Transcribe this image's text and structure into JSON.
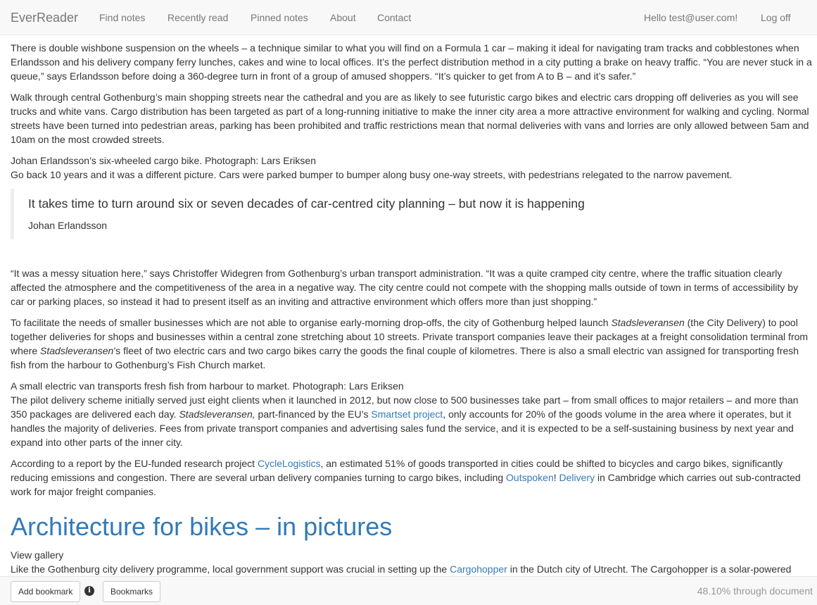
{
  "navbar": {
    "brand": "EverReader",
    "links": [
      "Find notes",
      "Recently read",
      "Pinned notes",
      "About",
      "Contact"
    ],
    "greeting": "Hello test@user.com!",
    "logout": "Log off"
  },
  "article": {
    "p1": "There is double wishbone suspension on the wheels – a technique similar to what you will find on a Formula 1 car – making it ideal for navigating tram tracks and cobblestones when Erlandsson and his delivery company ferry lunches, cakes and wine to local offices. It’s the perfect distribution method in a city putting a brake on heavy traffic. “You are never stuck in a queue,” says Erlandsson before doing a 360-degree turn in front of a group of amused shoppers. “It’s quicker to get from A to B – and it’s safer.”",
    "p2": "Walk through central Gothenburg’s main shopping streets near the cathedral and you are as likely to see futuristic cargo bikes and electric cars dropping off deliveries as you will see trucks and white vans. Cargo distribution has been targeted as part of a long-running initiative to make the inner city area a more attractive environment for walking and cycling. Normal streets have been turned into pedestrian areas, parking has been prohibited and traffic restrictions mean that normal deliveries with vans and lorries are only allowed between 5am and 10am on the most crowded streets.",
    "caption1": "Johan Erlandsson’s six-wheeled cargo bike. Photograph: Lars Eriksen",
    "p3": "Go back 10 years and it was a different picture. Cars were parked bumper to bumper along busy one-way streets, with pedestrians relegated to the narrow pavement.",
    "quote": "It takes time to turn around six or seven decades of car-centred city planning – but now it is happening",
    "quote_author": "Johan Erlandsson",
    "p4": "“It was a messy situation here,” says Christoffer Widegren from Gothenburg’s urban transport administration. “It was a quite cramped city centre, where the traffic situation clearly affected the atmosphere and the competitiveness of the area in a negative way. The city centre could not compete with the shopping malls outside of town in terms of accessibility by car or parking places, so instead it had to present itself as an inviting and attractive environment which offers more than just shopping.”",
    "p5": {
      "a": "To facilitate the needs of smaller businesses which are not able to organise early-morning drop-offs, the city of Gothenburg helped launch ",
      "em1": "Stadsleveransen",
      "b": " (the City Delivery) to pool together deliveries for shops and businesses within a central zone stretching about 10 streets. Private transport companies leave their packages at a freight consolidation terminal from where ",
      "em2": "Stadsleveransen",
      "c": "’s fleet of two electric cars and two cargo bikes carry the goods the final couple of kilometres. There is also a small electric van assigned for transporting fresh fish from the harbour to Gothenburg’s Fish Church market."
    },
    "caption2": "A small electric van transports fresh fish from harbour to market. Photograph: Lars Eriksen",
    "p6": {
      "a": "The pilot delivery scheme initially served just eight clients when it launched in 2012, but now close to 500 businesses take part – from small offices to major retailers – and more than 350 packages are delivered each day. ",
      "em": "Stadsleveransen,",
      "b": " part-financed by the EU’s ",
      "link": "Smartset project",
      "c": ", only accounts for 20% of the goods volume in the area where it operates, but it handles the majority of deliveries. Fees from private transport companies and advertising sales fund the service, and it is expected to be a self-sustaining business by next year and expand into other parts of the inner city."
    },
    "p7": {
      "a": "According to a report by the EU-funded research project ",
      "link1": "CycleLogistics",
      "b": ", an estimated 51% of goods transported in cities could be shifted to bicycles and cargo bikes, significantly reducing emissions and congestion. There are several urban delivery companies turning to cargo bikes, including ",
      "link2a": "Outspoken",
      "bang": "!",
      "link2b": " Delivery",
      "c": " in Cambridge which carries out sub-contracted work for major freight companies."
    },
    "heading": "Architecture for bikes – in pictures",
    "view_gallery": "View gallery",
    "p8": {
      "a": "Like the Gothenburg city delivery programme, local government support was crucial in setting up the ",
      "link": "Cargohopper",
      "b": " in the Dutch city of Utrecht. The Cargohopper is a solar-powered electric caravan of trailers which, according to the organisers, can do the work of five vans, cutting 30 tonnes of CO2 emissions on a yearly basis. While Utrecht city council does not"
    }
  },
  "footer": {
    "add_bookmark": "Add bookmark",
    "info_icon": "i",
    "bookmarks": "Bookmarks",
    "progress": "48.10% through document"
  }
}
